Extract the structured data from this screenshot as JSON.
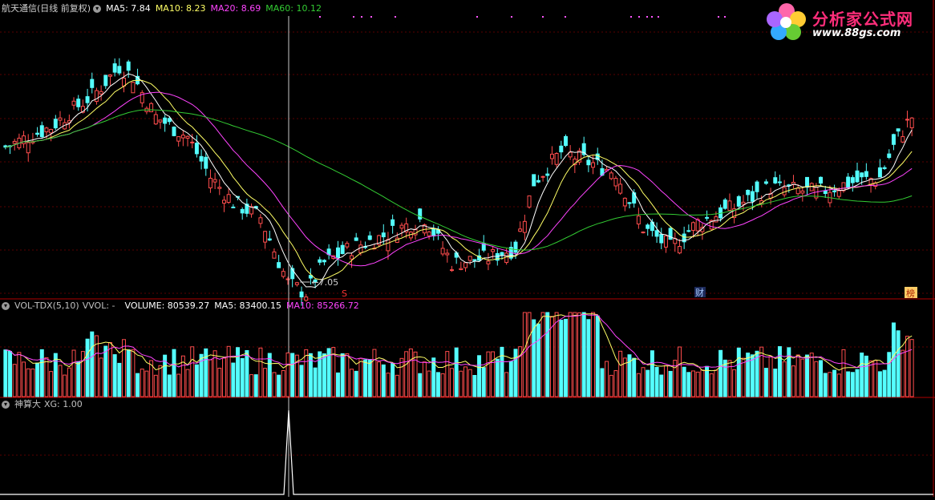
{
  "colors": {
    "up": "#ff4d4d",
    "down": "#54ffff",
    "ma5": "#ffffff",
    "ma10": "#ffff66",
    "ma20": "#ff44ff",
    "ma60": "#33cc33",
    "grid": "#5a0000",
    "frame": "#b00000"
  },
  "header": {
    "stock_name": "航天通信(日线 前复权)",
    "ma5": "MA5: 7.84",
    "ma10": "MA10: 8.23",
    "ma20": "MA20: 8.69",
    "ma60": "MA60: 10.12"
  },
  "volume_header": {
    "name": "VOL-TDX(5,10)",
    "vvol": "VVOL: -",
    "volume": "VOLUME: 80539.27",
    "ma5": "MA5: 83400.15",
    "ma10": "MA10: 85266.72"
  },
  "indicator_header": {
    "name": "神算大",
    "xg": "XG: 1.00"
  },
  "annotations": {
    "low_price": "7.05",
    "marker_s": "S",
    "marker_cai": "财",
    "marker_bang": "榜"
  },
  "logo": {
    "title": "分析家公式网",
    "url": "www.88gs.com"
  },
  "chart_data": [
    {
      "type": "candlestick",
      "title": "航天通信(日线 前复权)",
      "ylim": [
        7.0,
        12.6
      ],
      "series": [
        {
          "name": "MA5",
          "value": 7.84
        },
        {
          "name": "MA10",
          "value": 8.23
        },
        {
          "name": "MA20",
          "value": 8.69
        },
        {
          "name": "MA60",
          "value": 10.12
        }
      ],
      "annotated_low": 7.05
    },
    {
      "type": "bar",
      "title": "VOL-TDX(5,10)",
      "series": [
        {
          "name": "VOLUME",
          "value": 80539.27
        },
        {
          "name": "MA5",
          "value": 83400.15
        },
        {
          "name": "MA10",
          "value": 85266.72
        }
      ]
    },
    {
      "type": "line",
      "title": "神算大",
      "series": [
        {
          "name": "XG",
          "value": 1.0
        }
      ]
    }
  ]
}
